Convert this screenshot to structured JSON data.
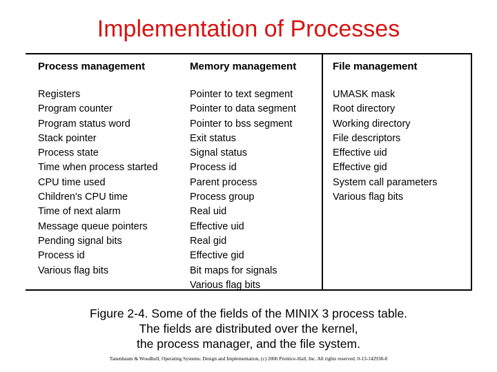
{
  "slide": {
    "title": "Implementation of Processes",
    "title_color": "#d81212",
    "background_color": "#ffffff",
    "text_color": "#000000",
    "border_color": "#000000"
  },
  "table": {
    "columns": [
      {
        "header": "Process management",
        "items": [
          "Registers",
          "Program counter",
          "Program status word",
          "Stack pointer",
          "Process state",
          "Time when process started",
          "CPU time used",
          "Children's CPU time",
          "Time of next alarm",
          "Message queue pointers",
          "Pending signal bits",
          "Process id",
          "Various flag bits"
        ]
      },
      {
        "header": "Memory management",
        "items": [
          "Pointer to text segment",
          "Pointer to data segment",
          "Pointer to bss segment",
          "Exit status",
          "Signal status",
          "Process id",
          "Parent process",
          "Process group",
          "Real uid",
          "Effective uid",
          "Real gid",
          "Effective gid",
          "Bit maps for signals",
          "Various flag bits"
        ]
      },
      {
        "header": "File management",
        "items": [
          "UMASK mask",
          "Root directory",
          "Working directory",
          "File descriptors",
          "Effective uid",
          "Effective gid",
          "System call parameters",
          "Various flag bits"
        ]
      }
    ]
  },
  "caption": {
    "line1": "Figure 2-4. Some of the fields of the MINIX 3 process table.",
    "line2": "The fields are distributed over the kernel,",
    "line3": "the process manager, and the file system."
  },
  "footer": {
    "copyright": "Tanenbaum & Woodhull, Operating Systems: Design and Implementation, (c) 2006 Prentice-Hall, Inc. All rights reserved. 0-13-142938-8"
  }
}
